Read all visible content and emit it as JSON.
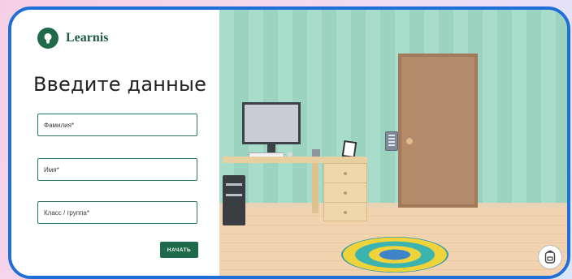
{
  "brand": {
    "name": "Learnis",
    "icon": "lightbulb-icon"
  },
  "form": {
    "heading": "Введите данные",
    "fields": [
      {
        "placeholder": "Фамилия*",
        "value": ""
      },
      {
        "placeholder": "Имя*",
        "value": ""
      },
      {
        "placeholder": "Класс / группа*",
        "value": ""
      }
    ],
    "start_button": "НАЧАТЬ"
  },
  "scene": {
    "inventory_icon": "backpack-icon"
  },
  "colors": {
    "frame": "#1f6fd6",
    "brand_green": "#1e6a4a",
    "wall": "#a8dccb"
  }
}
